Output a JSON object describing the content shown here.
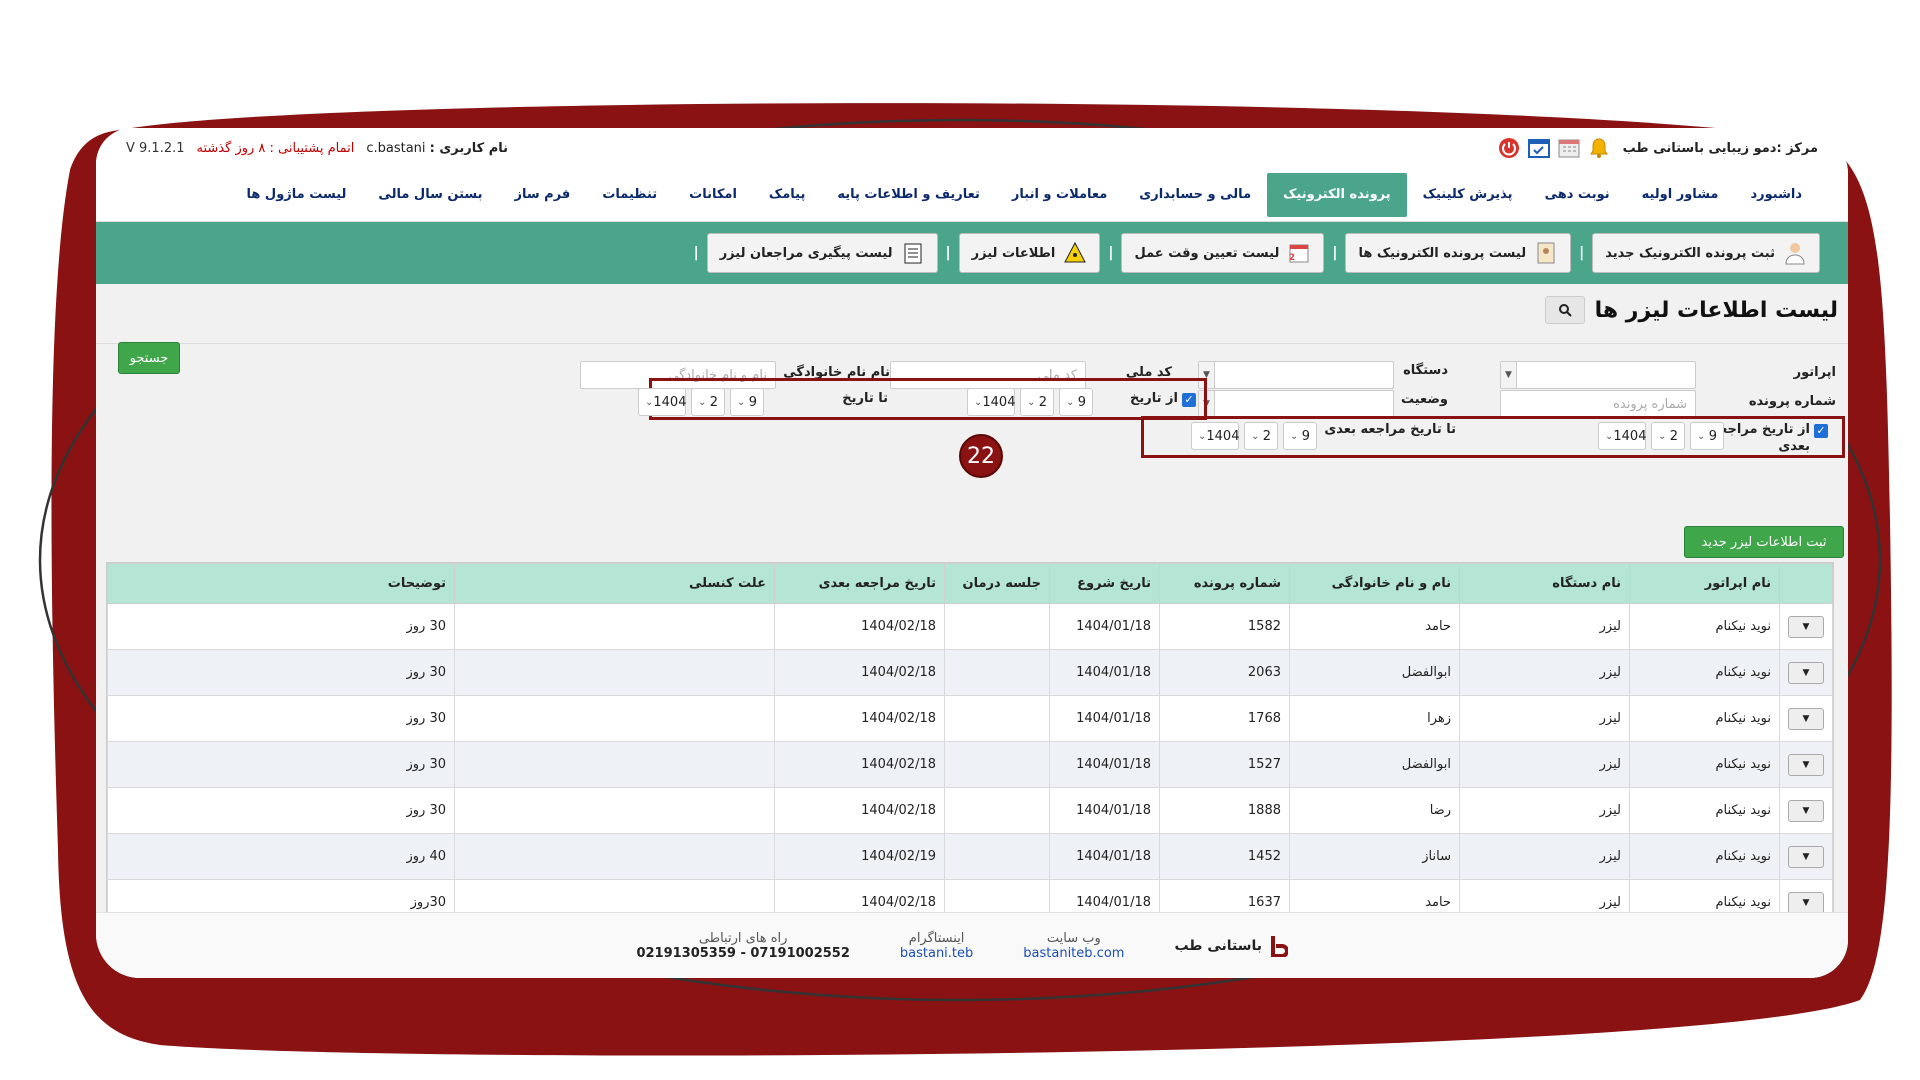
{
  "header": {
    "center_name": "مرکز :دمو زیبایی باستانی طب",
    "user_label": "نام کاربری :",
    "user_name": "c.bastani",
    "support_warning": "اتمام پشتیبانی : ۸ روز گذشته",
    "version": "V 9.1.2.1"
  },
  "menu": [
    {
      "label": "داشبورد"
    },
    {
      "label": "مشاور اولیه"
    },
    {
      "label": "نوبت دهی"
    },
    {
      "label": "پذیرش کلینیک"
    },
    {
      "label": "پرونده الکترونیک",
      "active": true
    },
    {
      "label": "مالی و حسابداری"
    },
    {
      "label": "معاملات و انبار"
    },
    {
      "label": "تعاریف و اطلاعات پایه"
    },
    {
      "label": "پیامک"
    },
    {
      "label": "امکانات"
    },
    {
      "label": "تنظیمات"
    },
    {
      "label": "فرم ساز"
    },
    {
      "label": "بستن سال مالی"
    },
    {
      "label": "لیست ماژول ها"
    }
  ],
  "submenu": [
    {
      "label": "ثبت پرونده الکترونیک جدید",
      "icon": "doctor-icon"
    },
    {
      "label": "لیست پرونده الکترونیک ها",
      "icon": "file-icon"
    },
    {
      "label": "لیست تعیین وقت عمل",
      "icon": "calendar-icon"
    },
    {
      "label": "اطلاعات لیزر",
      "icon": "laser-warning-icon"
    },
    {
      "label": "لیست پیگیری مراجعان لیزر",
      "icon": "clipboard-icon"
    }
  ],
  "page": {
    "title": "لیست اطلاعات لیزر ها"
  },
  "filters": {
    "operator_label": "اپراتور",
    "device_label": "دستگاه",
    "national_code_label": "کد ملی",
    "national_code_placeholder": "کد ملی",
    "name_label": "نام نام خانوادگی",
    "name_placeholder": "نام و نام خانوادگی",
    "file_number_label": "شماره پرونده",
    "file_number_placeholder": "شماره پرونده",
    "status_label": "وضعیت",
    "from_date_label": "از تاریخ",
    "to_date_label": "تا تاریخ",
    "from_next_label_1": "از تاریخ مراجعه",
    "from_next_label_2": "بعدی",
    "to_next_label": "تا تاریخ مراجعه بعدی",
    "day": "9",
    "month": "2",
    "year": "1404",
    "search_button": "جستجو",
    "new_button": "ثبت اطلاعات لیزر جدید",
    "badge": "22"
  },
  "table": {
    "headers": [
      "نام اپراتور",
      "نام دستگاه",
      "نام و نام خانوادگی",
      "شماره پرونده",
      "تاریخ شروع",
      "جلسه درمان",
      "تاریخ مراجعه بعدی",
      "علت کنسلی",
      "توضیحات"
    ],
    "rows": [
      [
        "نوید نیکنام",
        "لیزر",
        "حامد",
        "1582",
        "1404/01/18",
        "",
        "1404/02/18",
        "",
        "30 روز"
      ],
      [
        "نوید نیکنام",
        "لیزر",
        "ابوالفضل",
        "2063",
        "1404/01/18",
        "",
        "1404/02/18",
        "",
        "30 روز"
      ],
      [
        "نوید نیکنام",
        "لیزر",
        "زهرا",
        "1768",
        "1404/01/18",
        "",
        "1404/02/18",
        "",
        "30 روز"
      ],
      [
        "نوید نیکنام",
        "لیزر",
        "ابوالفضل",
        "1527",
        "1404/01/18",
        "",
        "1404/02/18",
        "",
        "30 روز"
      ],
      [
        "نوید نیکنام",
        "لیزر",
        "رضا",
        "1888",
        "1404/01/18",
        "",
        "1404/02/18",
        "",
        "30 روز"
      ],
      [
        "نوید نیکنام",
        "لیزر",
        "ساناز",
        "1452",
        "1404/01/18",
        "",
        "1404/02/19",
        "",
        "40 روز"
      ],
      [
        "نوید نیکنام",
        "لیزر",
        "حامد",
        "1637",
        "1404/01/18",
        "",
        "1404/02/18",
        "",
        "30روز"
      ]
    ]
  },
  "footer": {
    "brand": "باستانی طب",
    "website_label": "وب سایت",
    "website": "bastaniteb.com",
    "instagram_label": "اینستاگرام",
    "instagram": "bastani.teb",
    "contact_label": "راه های ارتباطی",
    "contact": "07191002552 - 02191305359"
  },
  "colors": {
    "accent": "#4aa58a",
    "frame": "#8a1212",
    "header_row": "#b5e6d5",
    "button_green": "#3fa64a"
  }
}
